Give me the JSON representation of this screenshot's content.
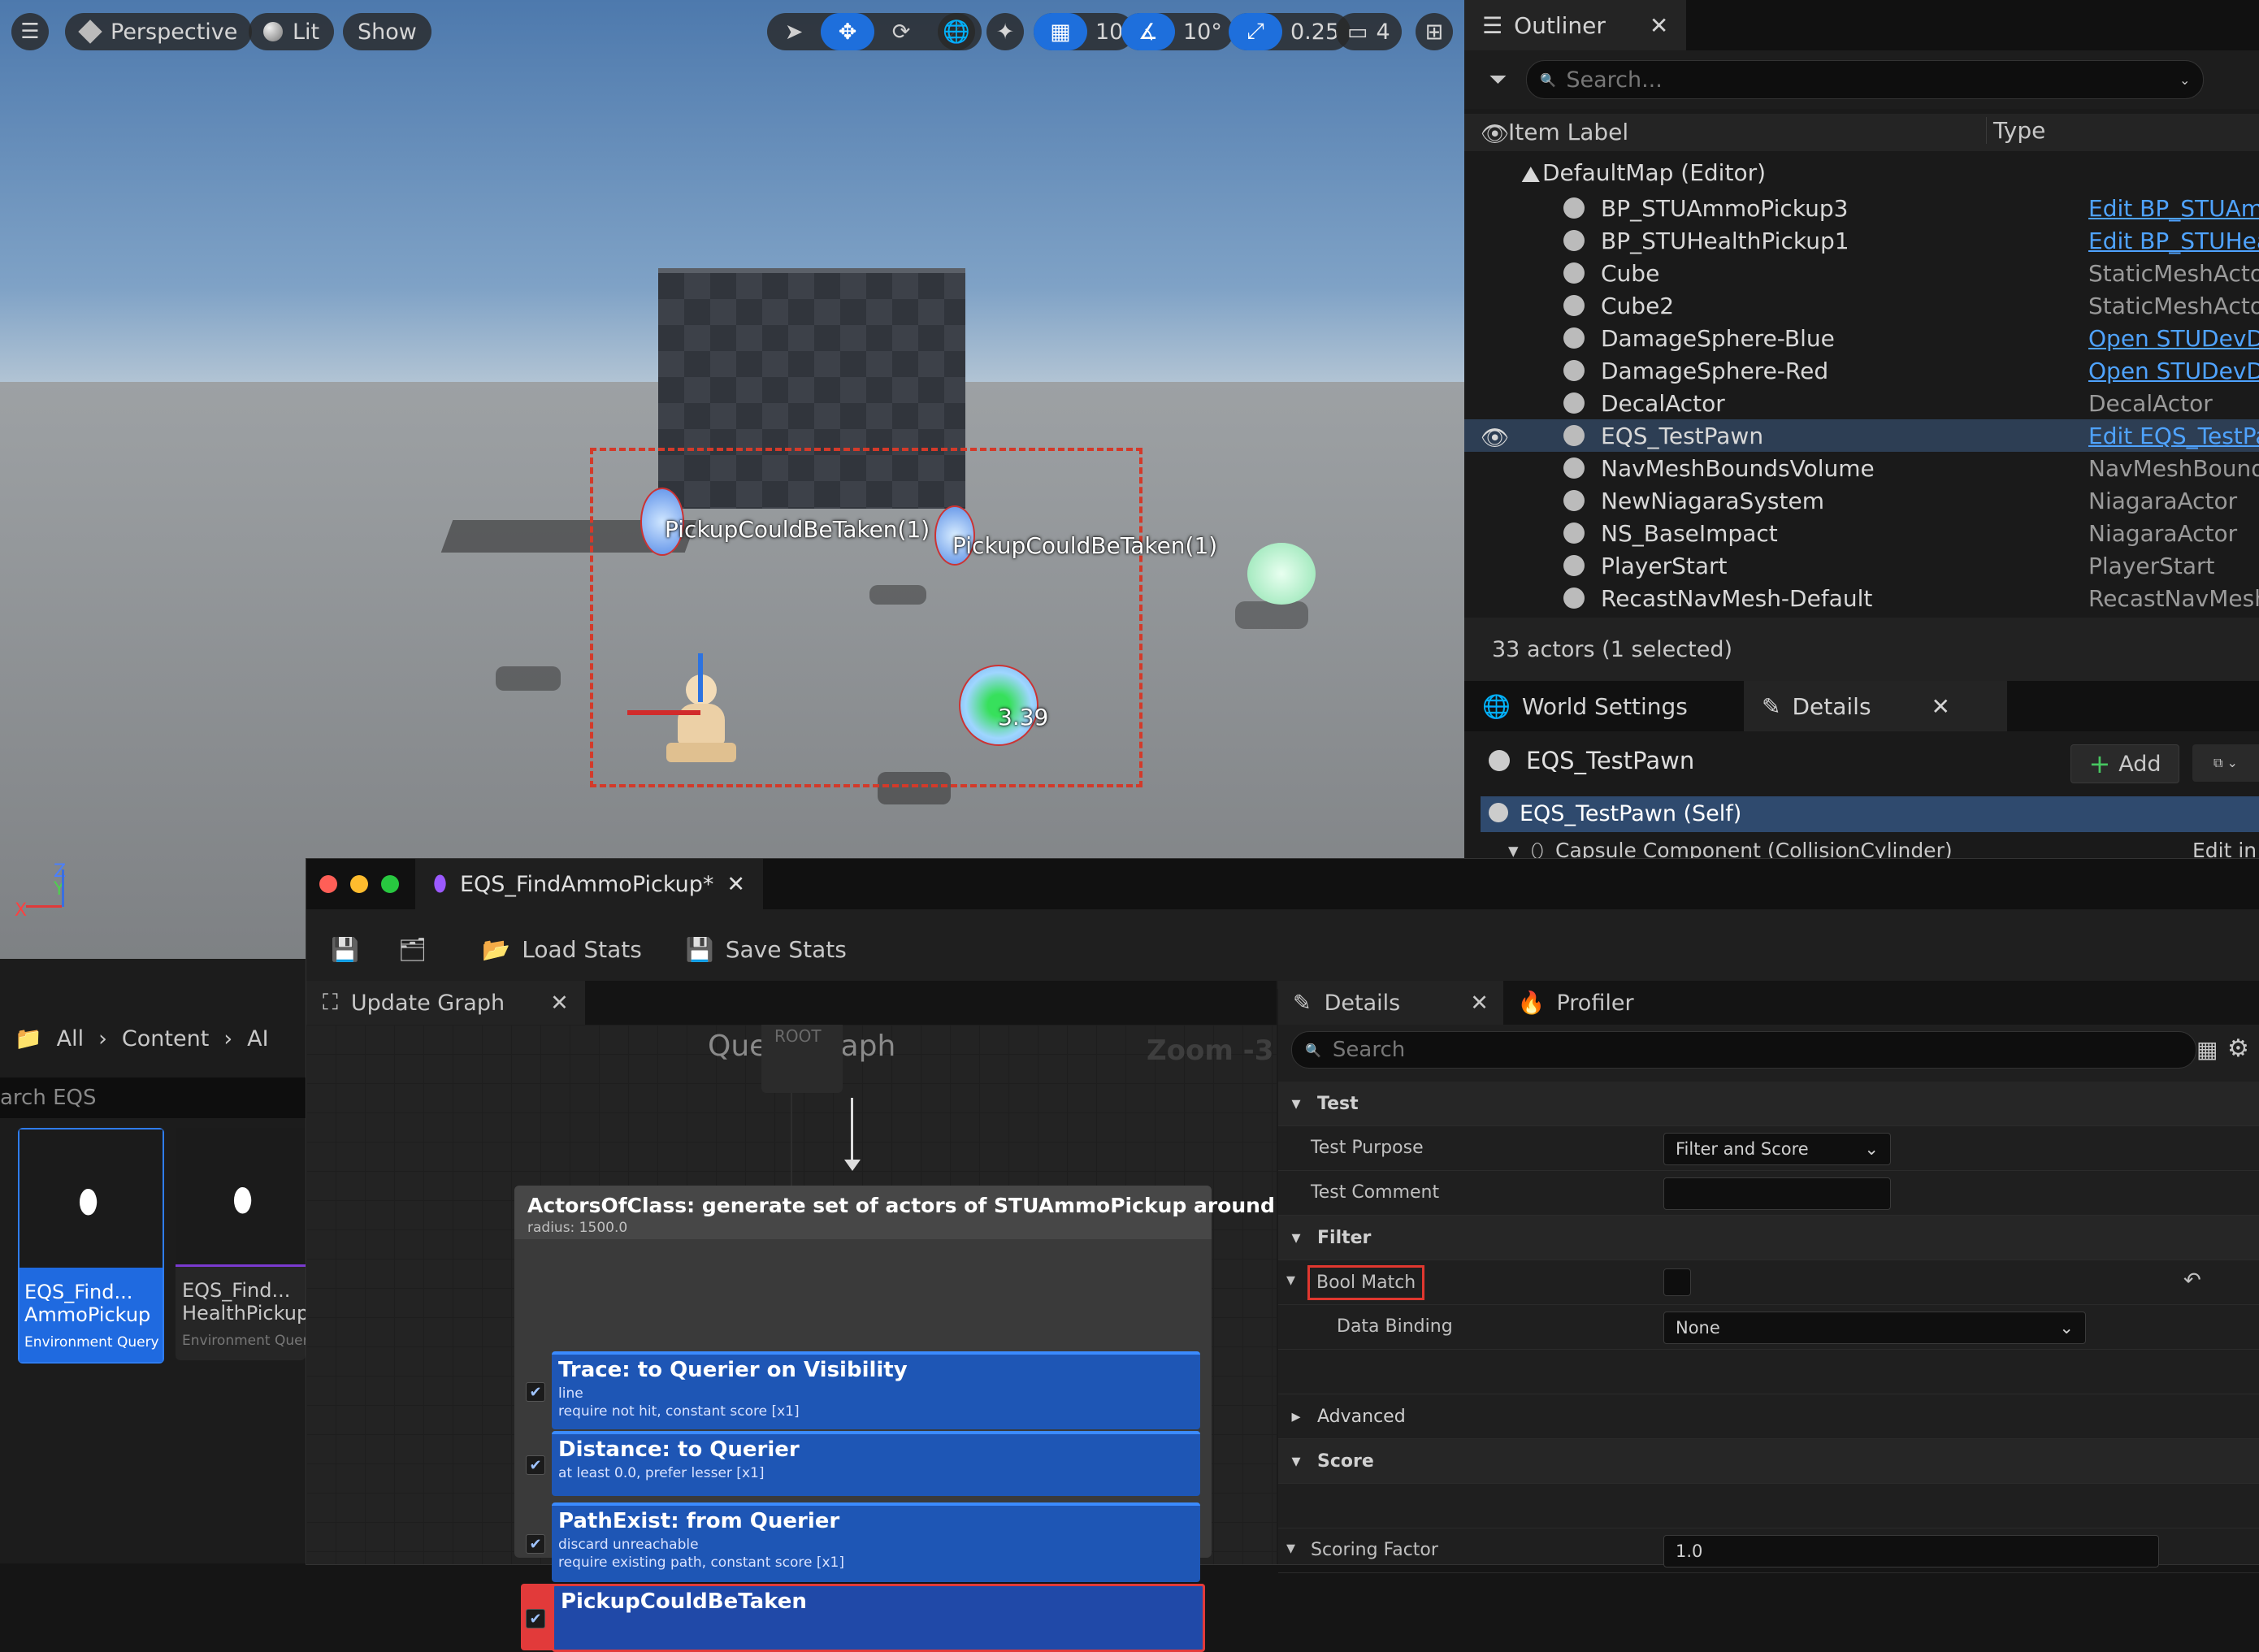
{
  "viewport": {
    "perspective_label": "Perspective",
    "lit_label": "Lit",
    "show_label": "Show",
    "grid_snap": "10",
    "rotation_snap": "10°",
    "scale_snap": "0.25",
    "camera_speed": "4",
    "labels": {
      "pickup_left": "PickupCouldBeTaken(1)",
      "pickup_right": "PickupCouldBeTaken(1)",
      "score": "3.39"
    },
    "axis": {
      "x": "X",
      "y": "Y",
      "z": "Z"
    }
  },
  "outliner": {
    "tab_label": "Outliner",
    "search_placeholder": "Search...",
    "col_label": "Item Label",
    "col_type": "Type",
    "root": "DefaultMap (Editor)",
    "rows": [
      {
        "name": "BP_STUAmmoPickup3",
        "type": "Edit BP_STUAmm",
        "link": true
      },
      {
        "name": "BP_STUHealthPickup1",
        "type": "Edit BP_STUHeal",
        "link": true
      },
      {
        "name": "Cube",
        "type": "StaticMeshActor",
        "link": false
      },
      {
        "name": "Cube2",
        "type": "StaticMeshActor",
        "link": false
      },
      {
        "name": "DamageSphere-Blue",
        "type": "Open STUDevDar",
        "link": true
      },
      {
        "name": "DamageSphere-Red",
        "type": "Open STUDevDar",
        "link": true
      },
      {
        "name": "DecalActor",
        "type": "DecalActor",
        "link": false
      },
      {
        "name": "EQS_TestPawn",
        "type": "Edit EQS_TestPa",
        "link": true,
        "selected": true
      },
      {
        "name": "NavMeshBoundsVolume",
        "type": "NavMeshBounds\\",
        "link": false
      },
      {
        "name": "NewNiagaraSystem",
        "type": "NiagaraActor",
        "link": false
      },
      {
        "name": "NS_BaseImpact",
        "type": "NiagaraActor",
        "link": false
      },
      {
        "name": "PlayerStart",
        "type": "PlayerStart",
        "link": false
      },
      {
        "name": "RecastNavMesh-Default",
        "type": "RecastNavMesh",
        "link": false
      }
    ],
    "status": "33 actors (1 selected)"
  },
  "world_details": {
    "tab_world_settings": "World Settings",
    "tab_details": "Details",
    "actor_name": "EQS_TestPawn",
    "add_label": "Add",
    "self_label": "EQS_TestPawn (Self)",
    "component": "Capsule Component (CollisionCylinder)",
    "component_action": "Edit in C"
  },
  "content": {
    "breadcrumb": [
      "All",
      "Content",
      "AI"
    ],
    "search_placeholder": "arch EQS",
    "assets": [
      {
        "line1": "EQS_Find...",
        "line2": "AmmoPickup",
        "type": "Environment Query",
        "selected": true
      },
      {
        "line1": "EQS_Find...",
        "line2": "HealthPickup",
        "type": "Environment Quer",
        "selected": false
      }
    ]
  },
  "eqs": {
    "tab_title": "EQS_FindAmmoPickup*",
    "load_stats": "Load Stats",
    "save_stats": "Save Stats",
    "graph_tab": "Update Graph",
    "graph_title": "Query Graph",
    "root_label": "ROOT",
    "zoom": "Zoom -3",
    "generator": {
      "title": "ActorsOfClass: generate set of actors of STUAmmoPickup around Querier",
      "sub": "radius: 1500.0"
    },
    "tests": [
      {
        "title": "Trace: to Querier on Visibility",
        "l1": "line",
        "l2": "require not hit, constant score [x1]"
      },
      {
        "title": "Distance: to Querier",
        "l1": "at least 0.0, prefer lesser [x1]",
        "l2": ""
      },
      {
        "title": "PathExist: from Querier",
        "l1": "discard unreachable",
        "l2": "require existing path, constant score [x1]"
      },
      {
        "title": "PickupCouldBeTaken",
        "l1": "",
        "l2": ""
      }
    ],
    "details_tab": "Details",
    "profiler_tab": "Profiler",
    "details_search": "Search",
    "sections": {
      "test": "Test",
      "filter": "Filter",
      "advanced": "Advanced",
      "score": "Score"
    },
    "props": {
      "test_purpose": "Test Purpose",
      "test_purpose_value": "Filter and Score",
      "test_comment": "Test Comment",
      "bool_match": "Bool Match",
      "data_binding": "Data Binding",
      "data_binding_value": "None",
      "scoring_factor": "Scoring Factor",
      "scoring_factor_value": "1.0"
    }
  }
}
